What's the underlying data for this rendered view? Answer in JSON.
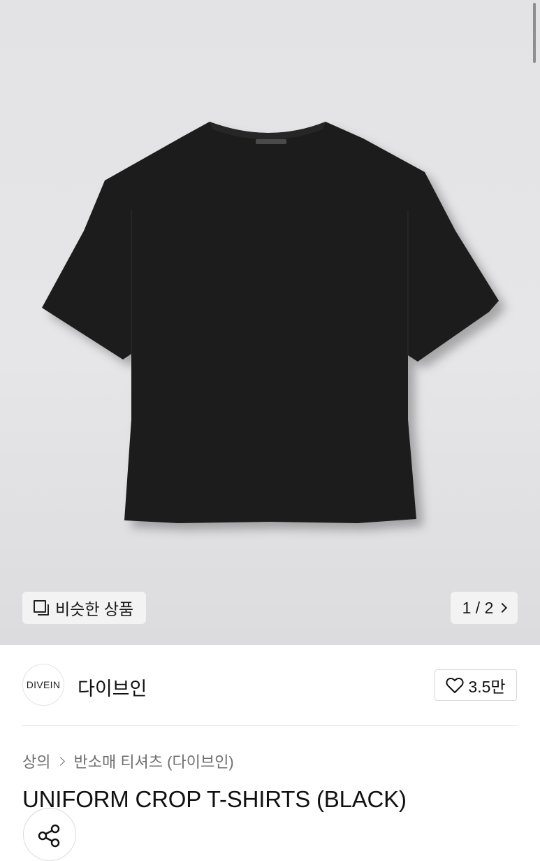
{
  "gallery": {
    "similar_label": "비슷한 상품",
    "pager_label": "1 / 2"
  },
  "brand": {
    "logo_text": "DIVEIN",
    "name": "다이브인",
    "likes": "3.5만"
  },
  "breadcrumb": {
    "category": "상의",
    "subcategory": "반소매 티셔츠 (다이브인)"
  },
  "product": {
    "title": "UNIFORM CROP T-SHIRTS (BLACK)"
  },
  "colors": {
    "hero_bg": "#e4e4e6",
    "shirt": "#1b1b1b",
    "text_primary": "#111111",
    "text_secondary": "#6f6f6f"
  },
  "icons": [
    "similar-items-icon",
    "chevron-right-icon",
    "heart-icon",
    "share-icon"
  ]
}
